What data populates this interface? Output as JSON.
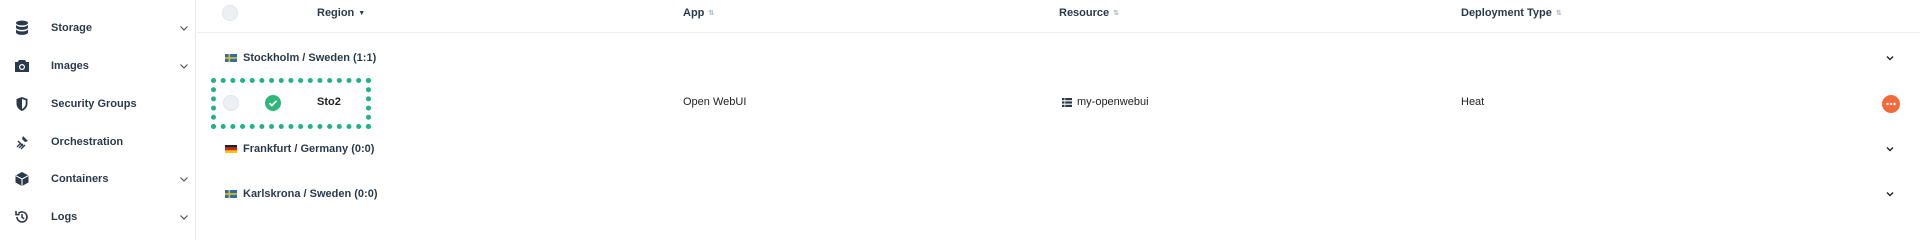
{
  "sidebar": {
    "items": [
      {
        "label": "Storage",
        "icon": "database-icon",
        "has_chevron": true
      },
      {
        "label": "Images",
        "icon": "camera-icon",
        "has_chevron": true
      },
      {
        "label": "Security Groups",
        "icon": "shield-icon",
        "has_chevron": false
      },
      {
        "label": "Orchestration",
        "icon": "orchestration-icon",
        "has_chevron": false
      },
      {
        "label": "Containers",
        "icon": "cube-icon",
        "has_chevron": true
      },
      {
        "label": "Logs",
        "icon": "history-icon",
        "has_chevron": true
      }
    ]
  },
  "table": {
    "columns": [
      {
        "label": "Region",
        "sort": "desc"
      },
      {
        "label": "App",
        "sort": "none"
      },
      {
        "label": "Resource",
        "sort": "none"
      },
      {
        "label": "Deployment Type",
        "sort": "none"
      }
    ],
    "groups": [
      {
        "label": "Stockholm / Sweden (1:1)",
        "flag": "sweden",
        "expanded": true
      },
      {
        "label": "Frankfurt / Germany (0:0)",
        "flag": "germany",
        "expanded": false
      },
      {
        "label": "Karlskrona / Sweden (0:0)",
        "flag": "sweden",
        "expanded": false
      }
    ],
    "rows": [
      {
        "status": "ok",
        "region": "Sto2",
        "app": "Open WebUI",
        "resource": "my-openwebui",
        "deployment_type": "Heat"
      }
    ]
  },
  "colors": {
    "accent_orange": "#f26b3a",
    "status_green": "#2db87a",
    "highlight_green": "#1fb38a",
    "text_dark": "#2b3a4b"
  }
}
